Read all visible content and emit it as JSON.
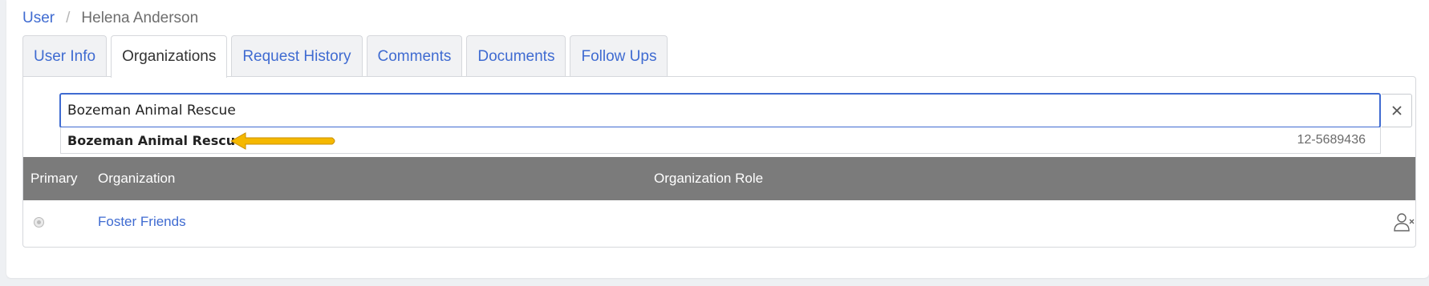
{
  "breadcrumb": {
    "parent": "User",
    "separator": "/",
    "current": "Helena Anderson"
  },
  "tabs": [
    {
      "label": "User Info",
      "active": false
    },
    {
      "label": "Organizations",
      "active": true
    },
    {
      "label": "Request History",
      "active": false
    },
    {
      "label": "Comments",
      "active": false
    },
    {
      "label": "Documents",
      "active": false
    },
    {
      "label": "Follow Ups",
      "active": false
    }
  ],
  "search": {
    "value": "Bozeman Animal Rescue",
    "clear_icon": "close-icon"
  },
  "suggestion": {
    "name": "Bozeman Animal Rescue",
    "ein": "12-5689436",
    "highlight_color": "#f5b800"
  },
  "table": {
    "headers": {
      "primary": "Primary",
      "organization": "Organization",
      "role": "Organization Role"
    },
    "rows": [
      {
        "primary": true,
        "organization": "Foster Friends",
        "role": "",
        "action_icon": "remove-user-icon"
      }
    ]
  },
  "colors": {
    "accent": "#3f6bd1",
    "header_bg": "#7b7b7b"
  }
}
